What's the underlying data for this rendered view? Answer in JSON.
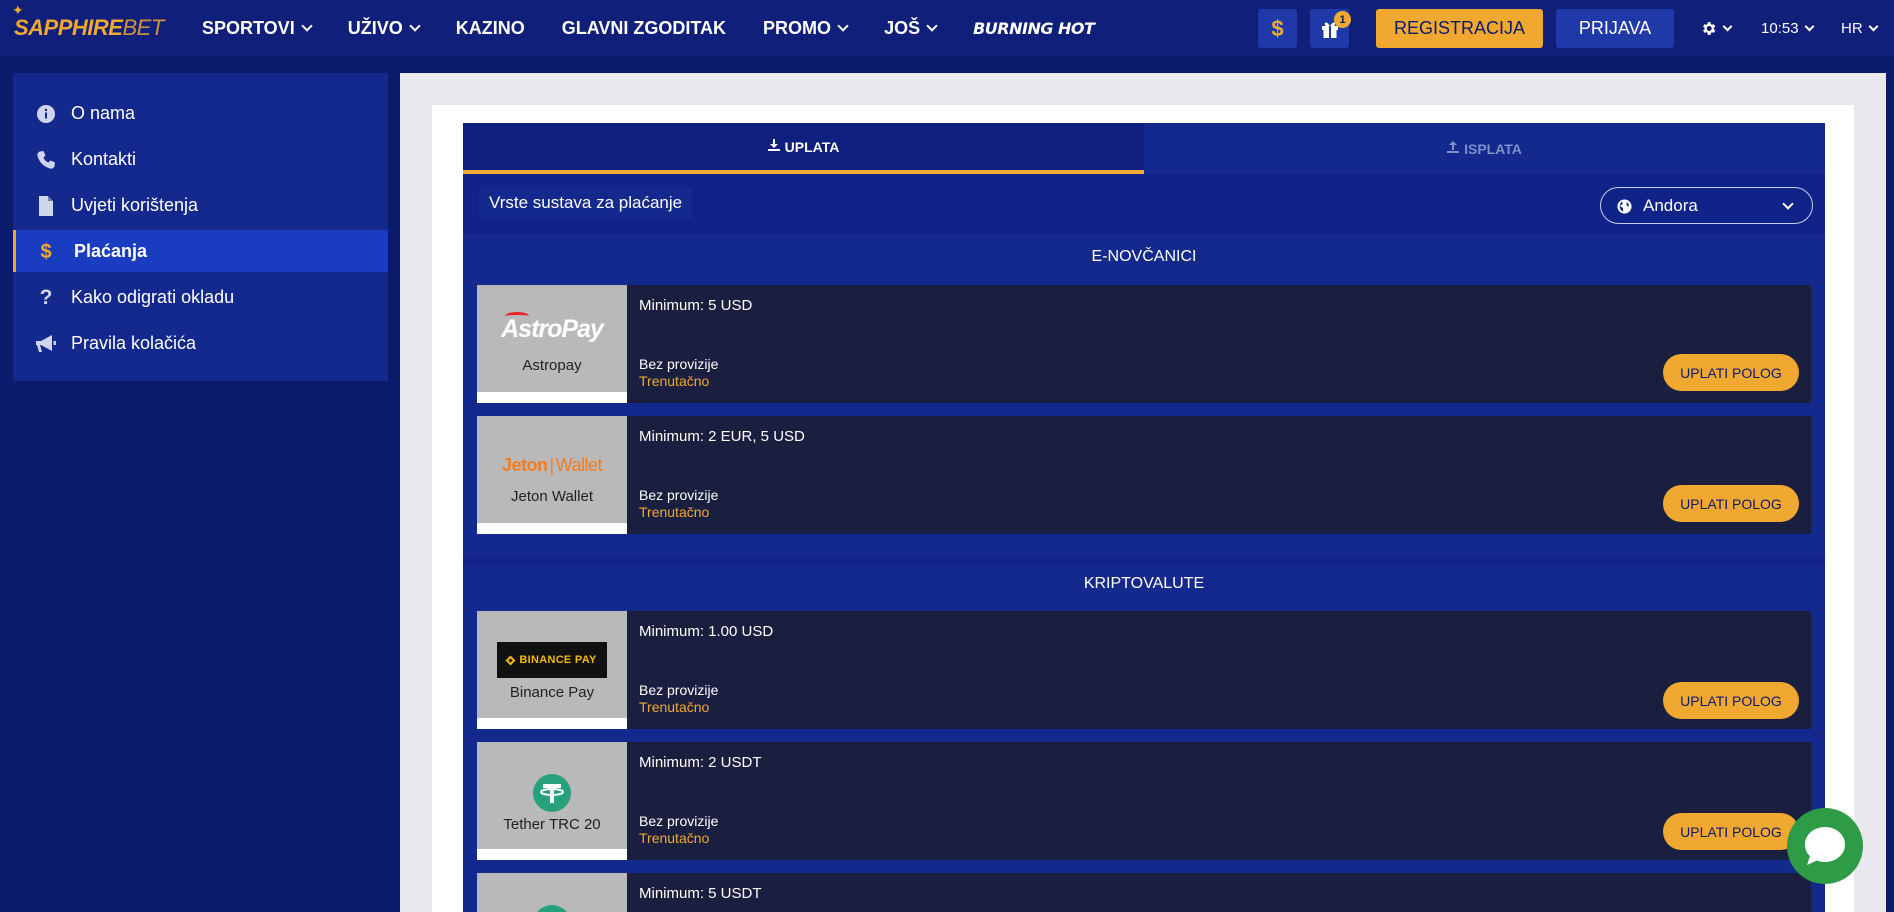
{
  "brand": {
    "logo_part1": "SAPPHIRE",
    "logo_part2": "BET"
  },
  "nav": {
    "items": [
      {
        "label": "SPORTOVI",
        "dropdown": true
      },
      {
        "label": "UŽIVO",
        "dropdown": true
      },
      {
        "label": "KAZINO",
        "dropdown": false
      },
      {
        "label": "GLAVNI ZGODITAK",
        "dropdown": false
      },
      {
        "label": "PROMO",
        "dropdown": true
      },
      {
        "label": "JOŠ",
        "dropdown": true
      },
      {
        "label": "BURNING HOT",
        "dropdown": false
      }
    ]
  },
  "header": {
    "currency_icon": "dollar-icon",
    "gift_icon": "gift-icon",
    "gift_badge": "1",
    "register_label": "REGISTRACIJA",
    "login_label": "PRIJAVA",
    "settings_icon": "gear-icon",
    "time": "10:53",
    "language": "HR"
  },
  "sidebar": {
    "items": [
      {
        "label": "O nama",
        "icon": "info-icon",
        "active": false
      },
      {
        "label": "Kontakti",
        "icon": "phone-icon",
        "active": false
      },
      {
        "label": "Uvjeti korištenja",
        "icon": "document-icon",
        "active": false
      },
      {
        "label": "Plaćanja",
        "icon": "dollar-icon",
        "active": true
      },
      {
        "label": "Kako odigrati okladu",
        "icon": "question-icon",
        "active": false
      },
      {
        "label": "Pravila kolačića",
        "icon": "megaphone-icon",
        "active": false
      }
    ]
  },
  "payments": {
    "tabs": [
      {
        "label": "UPLATA",
        "icon": "download-icon",
        "active": true
      },
      {
        "label": "ISPLATA",
        "icon": "upload-icon",
        "active": false
      }
    ],
    "title": "Vrste sustava za plaćanje",
    "country": "Andora",
    "sections": [
      {
        "title": "E-NOVČANICI",
        "methods": [
          {
            "name": "Astropay",
            "logo_text": "AstroPay",
            "minimum": "Minimum: 5 USD",
            "fee": "Bez provizije",
            "speed": "Trenutačno",
            "button": "UPLATI POLOG"
          },
          {
            "name": "Jeton Wallet",
            "logo_text_a": "Jeton",
            "logo_text_b": "Wallet",
            "minimum": "Minimum: 2 EUR, 5 USD",
            "fee": "Bez provizije",
            "speed": "Trenutačno",
            "button": "UPLATI POLOG"
          }
        ]
      },
      {
        "title": "KRIPTOVALUTE",
        "methods": [
          {
            "name": "Binance Pay",
            "logo_text": "BINANCE PAY",
            "minimum": "Minimum: 1.00 USD",
            "fee": "Bez provizije",
            "speed": "Trenutačno",
            "button": "UPLATI POLOG"
          },
          {
            "name": "Tether TRC 20",
            "minimum": "Minimum: 2 USDT",
            "fee": "Bez provizije",
            "speed": "Trenutačno",
            "button": "UPLATI POLOG"
          },
          {
            "minimum": "Minimum: 5 USDT"
          }
        ]
      }
    ]
  },
  "colors": {
    "accent": "#f0a830",
    "nav_bg": "#0f1f7a",
    "page_bg": "#0b1b6b",
    "card_bg": "#1b1f3f",
    "chat": "#2e9b46"
  }
}
